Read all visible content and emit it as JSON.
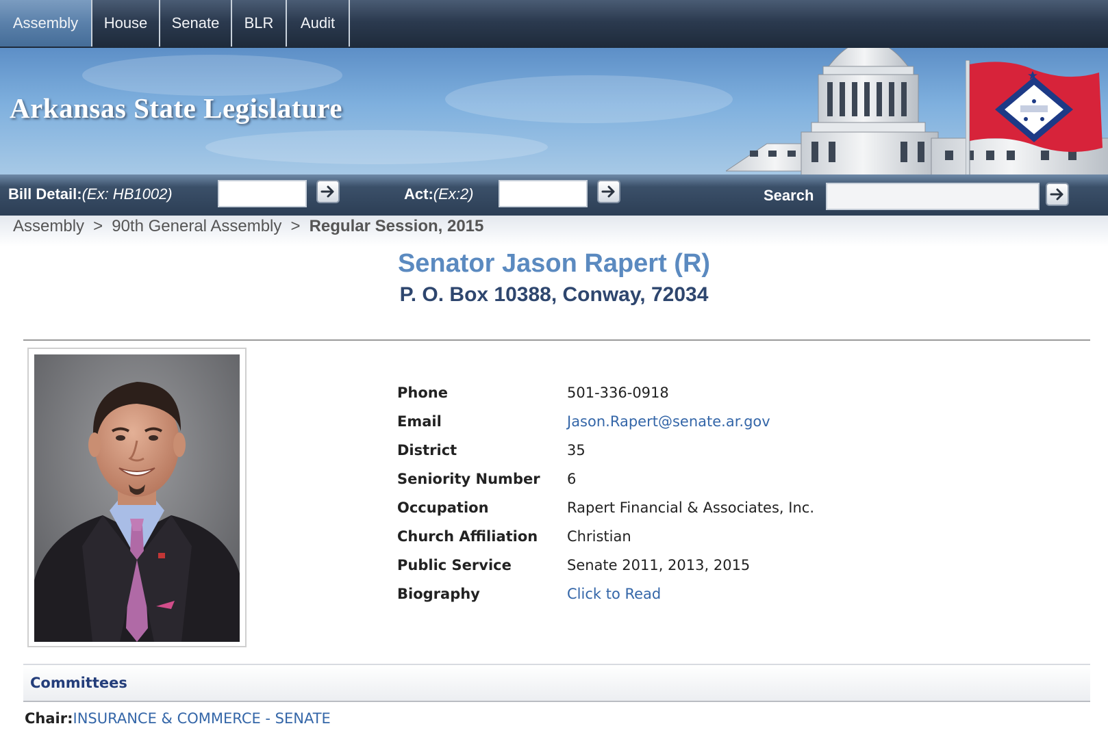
{
  "nav": {
    "tabs": [
      {
        "label": "Assembly",
        "active": true
      },
      {
        "label": "House",
        "active": false
      },
      {
        "label": "Senate",
        "active": false
      },
      {
        "label": "BLR",
        "active": false
      },
      {
        "label": "Audit",
        "active": false
      }
    ]
  },
  "banner": {
    "title": "Arkansas State Legislature"
  },
  "search_bar": {
    "bill_label": "Bill Detail:",
    "bill_hint": "(Ex: HB1002)",
    "act_label": "Act:",
    "act_hint": "(Ex:2)",
    "search_label": "Search",
    "bill_value": "",
    "act_value": "",
    "search_value": ""
  },
  "breadcrumb": {
    "items": [
      "Assembly",
      "90th General Assembly"
    ],
    "separator": ">",
    "current": "Regular Session, 2015"
  },
  "member": {
    "name": "Senator Jason Rapert (R)",
    "address": "P. O. Box 10388, Conway, 72034"
  },
  "details": [
    {
      "key": "Phone",
      "value": "501-336-0918",
      "link": false
    },
    {
      "key": "Email",
      "value": "Jason.Rapert@senate.ar.gov",
      "link": true
    },
    {
      "key": "District",
      "value": "35",
      "link": false
    },
    {
      "key": "Seniority Number",
      "value": "6",
      "link": false
    },
    {
      "key": "Occupation",
      "value": "Rapert Financial & Associates, Inc.",
      "link": false
    },
    {
      "key": "Church Affiliation",
      "value": "Christian",
      "link": false
    },
    {
      "key": "Public Service",
      "value": "Senate 2011, 2013, 2015",
      "link": false
    },
    {
      "key": "Biography",
      "value": "Click to Read",
      "link": true
    }
  ],
  "committees": {
    "heading": "Committees",
    "chair_label": "Chair:",
    "chair_value": "INSURANCE & COMMERCE - SENATE"
  },
  "colors": {
    "name_blue": "#5b8ac0",
    "address_navy": "#2e466e",
    "link_blue": "#3466a8",
    "nav_dark": "#2b3a4f"
  }
}
